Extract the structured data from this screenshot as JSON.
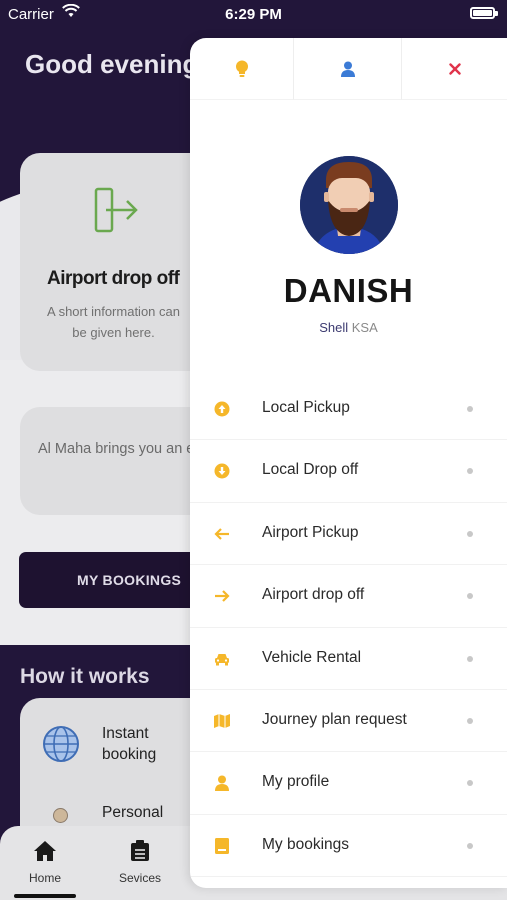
{
  "status_bar": {
    "carrier": "Carrier",
    "time": "6:29 PM"
  },
  "background": {
    "greeting": "Good evening rif!",
    "service_card": {
      "title": "Airport drop off",
      "description": "A short information can be given here."
    },
    "info_text": "Al Maha brings you an easy and convenient way to book",
    "my_bookings_button": "MY BOOKINGS",
    "how_it_works": {
      "title": "How it works",
      "items": [
        "Instant booking",
        "Personal"
      ]
    },
    "tabs": [
      {
        "label": "Home",
        "icon": "home-icon"
      },
      {
        "label": "Sevices",
        "icon": "clipboard-icon"
      }
    ]
  },
  "drawer": {
    "top_actions": [
      {
        "icon": "lightbulb-icon",
        "color": "#f5b72a"
      },
      {
        "icon": "user-icon",
        "color": "#3b7bd6"
      },
      {
        "icon": "close-icon",
        "color": "#e0334a"
      }
    ],
    "profile": {
      "name": "DANISH",
      "company_part1": "Shell",
      "company_part2": "KSA"
    },
    "menu": [
      {
        "label": "Local Pickup",
        "icon": "arrow-up-circle-icon"
      },
      {
        "label": "Local Drop off",
        "icon": "arrow-down-circle-icon"
      },
      {
        "label": "Airport Pickup",
        "icon": "arrow-left-icon"
      },
      {
        "label": "Airport drop off",
        "icon": "arrow-right-icon"
      },
      {
        "label": "Vehicle Rental",
        "icon": "car-icon"
      },
      {
        "label": "Journey plan request",
        "icon": "map-icon"
      },
      {
        "label": "My profile",
        "icon": "user-icon"
      },
      {
        "label": "My bookings",
        "icon": "book-icon"
      }
    ],
    "accent_color": "#f5b72a"
  }
}
